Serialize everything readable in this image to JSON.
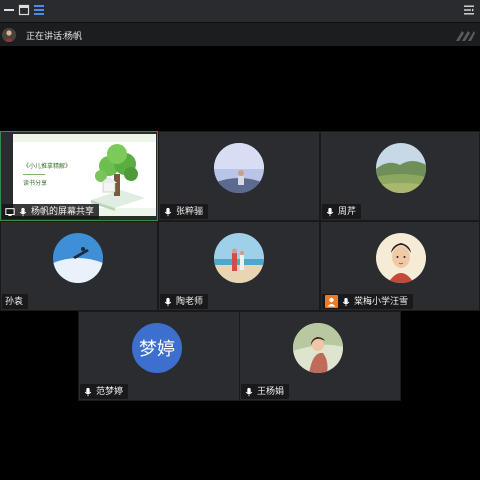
{
  "toolbar": {
    "icons": [
      "minimize-icon",
      "window-icon",
      "layout-list-icon",
      "collapse-panel-icon"
    ]
  },
  "speaking": {
    "label": "正在讲话:",
    "name": "杨帆"
  },
  "shared_screen": {
    "label": "杨帆的屏幕共享",
    "slide_title": "《小儿推拿精解》",
    "slide_subtitle": "读书分享"
  },
  "participants": [
    {
      "name": "张粹骊",
      "avatar": "photo-sky-person"
    },
    {
      "name": "周芹",
      "avatar": "photo-landscape"
    },
    {
      "name": "孙袁",
      "avatar": "photo-skier"
    },
    {
      "name": "陶老师",
      "avatar": "photo-beach"
    },
    {
      "name": "棠梅小学汪雪",
      "avatar": "illustration-woman"
    },
    {
      "name": "范梦婷",
      "avatar_text": "梦婷"
    },
    {
      "name": "王杨娟",
      "avatar": "photo-girl"
    }
  ],
  "colors": {
    "active_border": "#2f8f4a",
    "text_avatar_bg": "#3d6fcf",
    "tile_bg": "#2b2c2f"
  }
}
